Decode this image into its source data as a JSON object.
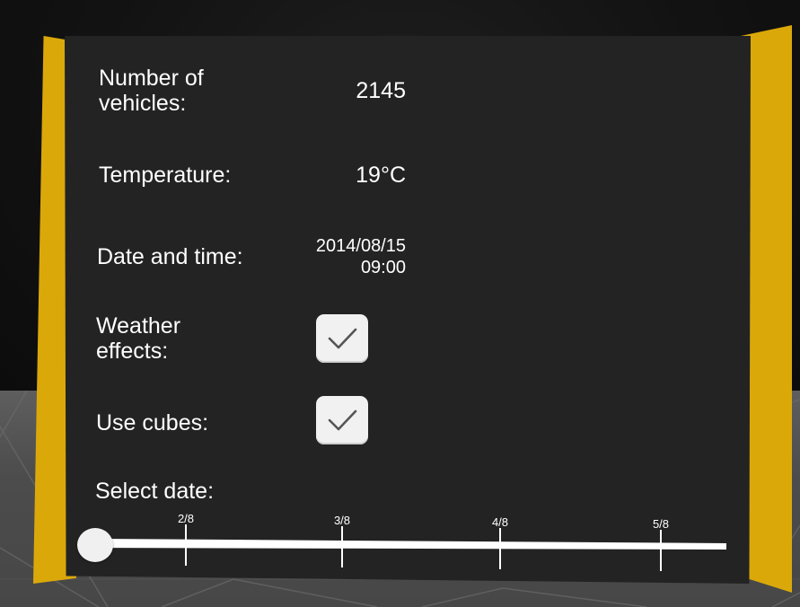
{
  "panel": {
    "vehicles": {
      "label": "Number of\nvehicles:",
      "value": "2145"
    },
    "temperature": {
      "label": "Temperature:",
      "value": "19°C"
    },
    "datetime": {
      "label": "Date and time:",
      "value": "2014/08/15\n09:00"
    },
    "weather": {
      "label": "Weather\neffects:",
      "checked": true
    },
    "cubes": {
      "label": "Use cubes:",
      "checked": true
    },
    "select_date": {
      "label": "Select date:"
    }
  },
  "slider": {
    "ticks": [
      "2/8",
      "3/8",
      "4/8",
      "5/8"
    ],
    "value": 0
  },
  "colors": {
    "panel": "#232323",
    "pillar": "#dba80a",
    "text": "#ffffff",
    "checkbox": "#f1f1f1",
    "checkmark": "#555555",
    "floor": "#4f4f4f"
  },
  "icons": {
    "weather_check": "checkmark-icon",
    "cubes_check": "checkmark-icon"
  }
}
